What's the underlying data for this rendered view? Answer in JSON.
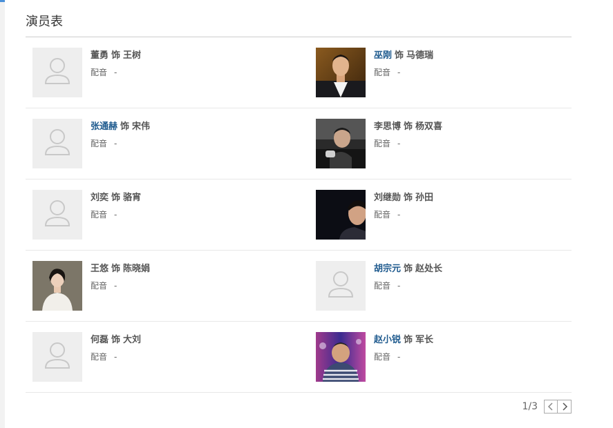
{
  "section": {
    "title": "演员表"
  },
  "cast": [
    {
      "actor": "董勇",
      "actor_linked": false,
      "as": "饰",
      "role": "王树",
      "dub_label": "配音",
      "dub_value": "-",
      "photo": "placeholder"
    },
    {
      "actor": "巫刚",
      "actor_linked": true,
      "as": "饰",
      "role": "马德瑞",
      "dub_label": "配音",
      "dub_value": "-",
      "photo": "man-white-shirt"
    },
    {
      "actor": "张通赫",
      "actor_linked": true,
      "as": "饰",
      "role": "宋伟",
      "dub_label": "配音",
      "dub_value": "-",
      "photo": "placeholder"
    },
    {
      "actor": "李思博",
      "actor_linked": false,
      "as": "饰",
      "role": "杨双喜",
      "dub_label": "配音",
      "dub_value": "-",
      "photo": "man-dark-jacket"
    },
    {
      "actor": "刘奕",
      "actor_linked": false,
      "as": "饰",
      "role": "骆宵",
      "dub_label": "配音",
      "dub_value": "-",
      "photo": "placeholder"
    },
    {
      "actor": "刘继勋",
      "actor_linked": false,
      "as": "饰",
      "role": "孙田",
      "dub_label": "配音",
      "dub_value": "-",
      "photo": "man-dark-background"
    },
    {
      "actor": "王悠",
      "actor_linked": false,
      "as": "饰",
      "role": "陈晓娟",
      "dub_label": "配音",
      "dub_value": "-",
      "photo": "woman-white-top"
    },
    {
      "actor": "胡宗元",
      "actor_linked": true,
      "as": "饰",
      "role": "赵处长",
      "dub_label": "配音",
      "dub_value": "-",
      "photo": "placeholder"
    },
    {
      "actor": "何磊",
      "actor_linked": false,
      "as": "饰",
      "role": "大刘",
      "dub_label": "配音",
      "dub_value": "-",
      "photo": "placeholder"
    },
    {
      "actor": "赵小锐",
      "actor_linked": true,
      "as": "饰",
      "role": "军长",
      "dub_label": "配音",
      "dub_value": "-",
      "photo": "man-striped-shirt"
    }
  ],
  "pager": {
    "current": "1",
    "total": "3",
    "text": "1/3",
    "prev_icon": "chevron-left-icon",
    "next_icon": "chevron-right-icon"
  },
  "colors": {
    "link": "#1e5a8e",
    "text": "#555555",
    "divider": "#e8e8e8",
    "placeholder_bg": "#eeeeee"
  }
}
